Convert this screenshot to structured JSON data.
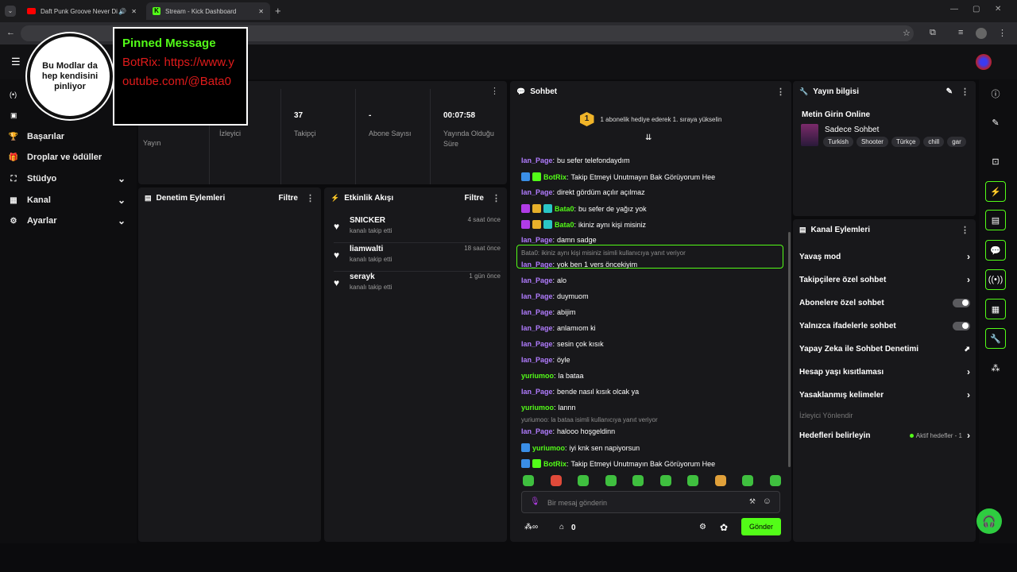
{
  "browser": {
    "tabs": [
      {
        "title": "Daft Punk Groove Never Di"
      },
      {
        "title": "Stream - Kick Dashboard"
      }
    ],
    "new_tab_label": "+"
  },
  "overlay": {
    "circle_text": "Bu Modlar da hep kendisini pinliyor",
    "pinned_title": "Pinned Message",
    "pinned_body": "BotRix: https://www.youtube.com/@Bata0"
  },
  "sidebar": {
    "items": [
      {
        "label": "Başarılar",
        "icon": "trophy-icon",
        "chevron": false
      },
      {
        "label": "Droplar ve ödüller",
        "icon": "gift-icon",
        "chevron": false
      },
      {
        "label": "Stüdyo",
        "icon": "studio-icon",
        "chevron": true
      },
      {
        "label": "Kanal",
        "icon": "channel-icon",
        "chevron": true
      },
      {
        "label": "Ayarlar",
        "icon": "gear-icon",
        "chevron": true
      }
    ]
  },
  "stats": [
    {
      "value": "",
      "label": "Yayın"
    },
    {
      "value": "",
      "label": "İzleyici"
    },
    {
      "value": "37",
      "label": "Takipçi"
    },
    {
      "value": "-",
      "label": "Abone Sayısı"
    },
    {
      "value": "00:07:58",
      "label": "Yayında Olduğu Süre"
    }
  ],
  "moderation": {
    "title": "Denetim Eylemleri",
    "filter": "Filtre"
  },
  "activity": {
    "title": "Etkinlik Akışı",
    "filter": "Filtre",
    "items": [
      {
        "name": "SNICKER",
        "action": "kanalı takip etti",
        "time": "4 saat önce"
      },
      {
        "name": "liamwalti",
        "action": "kanalı takip etti",
        "time": "18 saat önce"
      },
      {
        "name": "serayk",
        "action": "kanalı takip etti",
        "time": "1 gün önce"
      }
    ]
  },
  "chat": {
    "title": "Sohbet",
    "gift_rank": "1",
    "gift_text": "1 abonelik hediye ederek 1. sıraya yükselin",
    "messages": [
      {
        "user": "Ian_Page",
        "text": "bu sefer telefondaydım",
        "color": "#b17cff",
        "badges": []
      },
      {
        "user": "BotRix",
        "text": "Takip Etmeyi Unutmayın Bak Görüyorum Hee",
        "color": "#53fc18",
        "badges": [
          "#3a8ee6",
          "#53fc18"
        ]
      },
      {
        "user": "Ian_Page",
        "text": "direkt gördüm açılır açılmaz",
        "color": "#b17cff",
        "badges": []
      },
      {
        "user": "Bata0",
        "text": "bu sefer de yağız yok",
        "color": "#53fc18",
        "badges": [
          "#b13ce6",
          "#e6b02a",
          "#2ac6c6"
        ]
      },
      {
        "user": "Bata0",
        "text": "ikiniz aynı kişi misiniz",
        "color": "#53fc18",
        "badges": [
          "#b13ce6",
          "#e6b02a",
          "#2ac6c6"
        ]
      },
      {
        "user": "Ian_Page",
        "text": "damn sadge",
        "color": "#b17cff",
        "badges": []
      },
      {
        "user": "Ian_Page",
        "text": "yok ben 1 vers öncekiyim",
        "color": "#b17cff",
        "badges": [],
        "reply": "Bata0: ikiniz aynı kişi misiniz isimli kullanıcıya yanıt veriyor",
        "highlight": true
      },
      {
        "user": "Ian_Page",
        "text": "alo",
        "color": "#b17cff",
        "badges": []
      },
      {
        "user": "Ian_Page",
        "text": "duymuom",
        "color": "#b17cff",
        "badges": []
      },
      {
        "user": "Ian_Page",
        "text": "abijim",
        "color": "#b17cff",
        "badges": []
      },
      {
        "user": "Ian_Page",
        "text": "anlamıom ki",
        "color": "#b17cff",
        "badges": []
      },
      {
        "user": "Ian_Page",
        "text": "sesin çok kısık",
        "color": "#b17cff",
        "badges": []
      },
      {
        "user": "Ian_Page",
        "text": "öyle",
        "color": "#b17cff",
        "badges": []
      },
      {
        "user": "yuriumoo",
        "text": "la bataa",
        "color": "#53fc18",
        "badges": []
      },
      {
        "user": "Ian_Page",
        "text": "bende nasıl kısık olcak ya",
        "color": "#b17cff",
        "badges": []
      },
      {
        "user": "yuriumoo",
        "text": "lannn",
        "color": "#53fc18",
        "badges": []
      },
      {
        "user": "Ian_Page",
        "text": "halooo hoşgeldinn",
        "color": "#b17cff",
        "badges": [],
        "reply": "yuriumoo: la bataa isimli kullanıcıya yanıt veriyor"
      },
      {
        "user": "yuriumoo",
        "text": "iyi knk sen napiyorsun",
        "color": "#53fc18",
        "badges": [
          "#3a8ee6"
        ]
      },
      {
        "user": "BotRix",
        "text": "Takip Etmeyi Unutmayın Bak Görüyorum Hee",
        "color": "#53fc18",
        "badges": [
          "#3a8ee6",
          "#53fc18"
        ]
      }
    ],
    "input_placeholder": "Bir mesaj gönderin",
    "points": "0",
    "send_label": "Gönder"
  },
  "stream_info": {
    "title": "Yayın bilgisi",
    "stream_title": "Metin Girin Online",
    "category": "Sadece Sohbet",
    "tags": [
      "Turkish",
      "Shooter",
      "Türkçe",
      "chill",
      "gar"
    ]
  },
  "channel_actions": {
    "title": "Kanal Eylemleri",
    "items": [
      {
        "label": "Yavaş mod",
        "control": "chevron"
      },
      {
        "label": "Takipçilere özel sohbet",
        "control": "chevron"
      },
      {
        "label": "Abonelere özel sohbet",
        "control": "toggle"
      },
      {
        "label": "Yalnızca ifadelerle sohbet",
        "control": "toggle"
      },
      {
        "label": "Yapay Zeka ile Sohbet Denetimi",
        "control": "chart"
      },
      {
        "label": "Hesap yaşı kısıtlaması",
        "control": "chevron"
      },
      {
        "label": "Yasaklanmış kelimeler",
        "control": "chevron"
      }
    ],
    "redirect_label": "İzleyici Yönlendir",
    "goals_label": "Hedefleri belirleyin",
    "goals_status": "Aktif hedefler - 1"
  },
  "colors": {
    "accent": "#53fc18",
    "panel": "#18181b",
    "username_purple": "#b17cff"
  }
}
